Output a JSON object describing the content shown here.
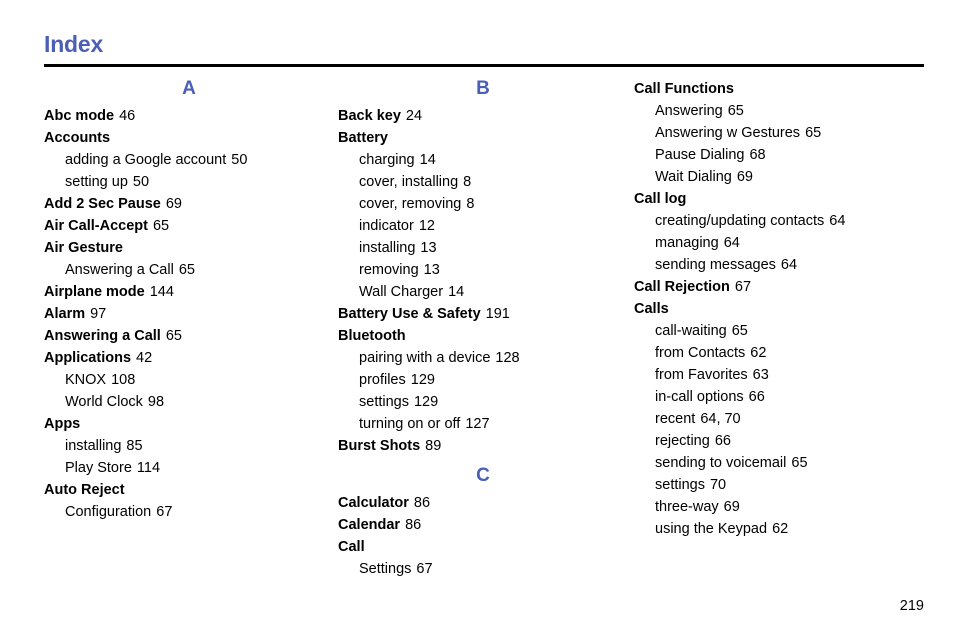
{
  "document": {
    "title": "Index",
    "folio": "219"
  },
  "columns": [
    {
      "id": "column-1",
      "letter_heading": "A",
      "entries": [
        {
          "level": "main",
          "term": "Abc mode",
          "pages": "46"
        },
        {
          "level": "main",
          "term": "Accounts",
          "pages": ""
        },
        {
          "level": "sub",
          "term": "adding a Google account",
          "pages": "50"
        },
        {
          "level": "sub",
          "term": "setting up",
          "pages": "50"
        },
        {
          "level": "main",
          "term": "Add 2 Sec Pause",
          "pages": "69"
        },
        {
          "level": "main",
          "term": "Air Call-Accept",
          "pages": "65"
        },
        {
          "level": "main",
          "term": "Air Gesture",
          "pages": ""
        },
        {
          "level": "sub",
          "term": "Answering a Call",
          "pages": "65"
        },
        {
          "level": "main",
          "term": "Airplane mode",
          "pages": "144"
        },
        {
          "level": "main",
          "term": "Alarm",
          "pages": "97"
        },
        {
          "level": "main",
          "term": "Answering a Call",
          "pages": "65"
        },
        {
          "level": "main",
          "term": "Applications",
          "pages": "42"
        },
        {
          "level": "sub",
          "term": "KNOX",
          "pages": "108"
        },
        {
          "level": "sub",
          "term": "World Clock",
          "pages": "98"
        },
        {
          "level": "main",
          "term": "Apps",
          "pages": ""
        },
        {
          "level": "sub",
          "term": "installing",
          "pages": "85"
        },
        {
          "level": "sub",
          "term": "Play Store",
          "pages": "114"
        },
        {
          "level": "main",
          "term": "Auto Reject",
          "pages": ""
        },
        {
          "level": "sub",
          "term": "Configuration",
          "pages": "67"
        }
      ]
    },
    {
      "id": "column-2",
      "letter_heading": "B",
      "entries": [
        {
          "level": "main",
          "term": "Back key",
          "pages": "24"
        },
        {
          "level": "main",
          "term": "Battery",
          "pages": ""
        },
        {
          "level": "sub",
          "term": "charging",
          "pages": "14"
        },
        {
          "level": "sub",
          "term": "cover, installing",
          "pages": "8"
        },
        {
          "level": "sub",
          "term": "cover, removing",
          "pages": "8"
        },
        {
          "level": "sub",
          "term": "indicator",
          "pages": "12"
        },
        {
          "level": "sub",
          "term": "installing",
          "pages": "13"
        },
        {
          "level": "sub",
          "term": "removing",
          "pages": "13"
        },
        {
          "level": "sub",
          "term": "Wall Charger",
          "pages": "14"
        },
        {
          "level": "main",
          "term": "Battery Use & Safety",
          "pages": "191"
        },
        {
          "level": "main",
          "term": "Bluetooth",
          "pages": ""
        },
        {
          "level": "sub",
          "term": "pairing with a device",
          "pages": "128"
        },
        {
          "level": "sub",
          "term": "profiles",
          "pages": "129"
        },
        {
          "level": "sub",
          "term": "settings",
          "pages": "129"
        },
        {
          "level": "sub",
          "term": "turning on or off",
          "pages": "127"
        },
        {
          "level": "main",
          "term": "Burst Shots",
          "pages": "89"
        }
      ],
      "second_letter_heading": "C",
      "entries_after": [
        {
          "level": "main",
          "term": "Calculator",
          "pages": "86"
        },
        {
          "level": "main",
          "term": "Calendar",
          "pages": "86"
        },
        {
          "level": "main",
          "term": "Call",
          "pages": ""
        },
        {
          "level": "sub",
          "term": "Settings",
          "pages": "67"
        }
      ]
    },
    {
      "id": "column-3",
      "letter_heading": "",
      "entries": [
        {
          "level": "main",
          "term": "Call Functions",
          "pages": ""
        },
        {
          "level": "sub",
          "term": "Answering",
          "pages": "65"
        },
        {
          "level": "sub",
          "term": "Answering w Gestures",
          "pages": "65"
        },
        {
          "level": "sub",
          "term": "Pause Dialing",
          "pages": "68"
        },
        {
          "level": "sub",
          "term": "Wait Dialing",
          "pages": "69"
        },
        {
          "level": "main",
          "term": "Call log",
          "pages": ""
        },
        {
          "level": "sub",
          "term": "creating/updating contacts",
          "pages": "64"
        },
        {
          "level": "sub",
          "term": "managing",
          "pages": "64"
        },
        {
          "level": "sub",
          "term": "sending messages",
          "pages": "64"
        },
        {
          "level": "main",
          "term": "Call Rejection",
          "pages": "67"
        },
        {
          "level": "main",
          "term": "Calls",
          "pages": ""
        },
        {
          "level": "sub",
          "term": "call-waiting",
          "pages": "65"
        },
        {
          "level": "sub",
          "term": "from Contacts",
          "pages": "62"
        },
        {
          "level": "sub",
          "term": "from Favorites",
          "pages": "63"
        },
        {
          "level": "sub",
          "term": "in-call options",
          "pages": "66"
        },
        {
          "level": "sub",
          "term": "recent",
          "pages": "64, 70"
        },
        {
          "level": "sub",
          "term": "rejecting",
          "pages": "66"
        },
        {
          "level": "sub",
          "term": "sending to voicemail",
          "pages": "65"
        },
        {
          "level": "sub",
          "term": "settings",
          "pages": "70"
        },
        {
          "level": "sub",
          "term": "three-way",
          "pages": "69"
        },
        {
          "level": "sub",
          "term": "using the Keypad",
          "pages": "62"
        }
      ]
    }
  ],
  "colors": {
    "heading_blue": "#4a5fb5",
    "text_black": "#000000",
    "background": "#ffffff"
  }
}
